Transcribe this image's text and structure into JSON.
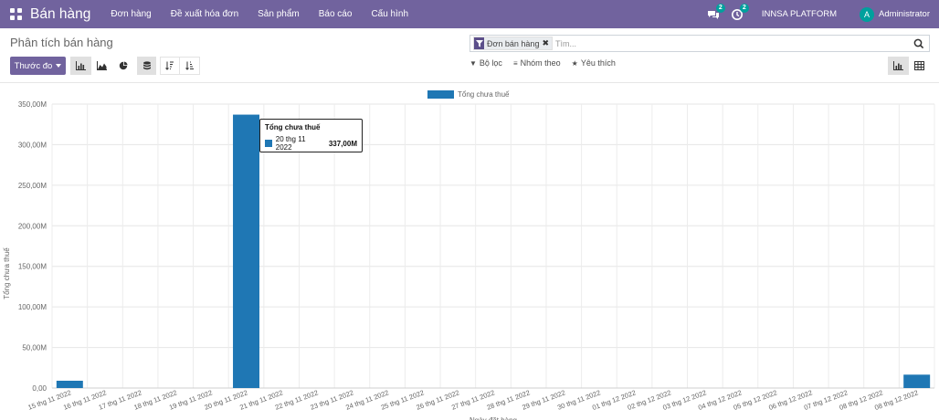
{
  "navbar": {
    "app_name": "Bán hàng",
    "menu": [
      "Đơn hàng",
      "Đề xuất hóa đơn",
      "Sản phẩm",
      "Báo cáo",
      "Cấu hình"
    ],
    "messages_count": "2",
    "activities_count": "2",
    "company": "INNSA PLATFORM",
    "user_initial": "A",
    "user_name": "Administrator"
  },
  "control_panel": {
    "breadcrumb": "Phân tích bán hàng",
    "measures_label": "Thước đo",
    "search": {
      "facet_label": "Đơn bán hàng",
      "placeholder": "Tìm..."
    },
    "filters_label": "Bộ lọc",
    "group_by_label": "Nhóm theo",
    "favorites_label": "Yêu thích"
  },
  "tooltip": {
    "title": "Tổng chưa thuế",
    "label": "20 thg 11 2022",
    "value": "337,00M"
  },
  "colors": {
    "navbar": "#71639e",
    "bar": "#1f77b4",
    "badge": "#00a09d"
  },
  "chart_data": {
    "type": "bar",
    "ylabel": "Tổng chưa thuế",
    "xlabel": "Ngày đặt hàng",
    "ylim": [
      0,
      350
    ],
    "yticks": [
      "0,00",
      "50,00M",
      "100,00M",
      "150,00M",
      "200,00M",
      "250,00M",
      "300,00M",
      "350,00M"
    ],
    "grid": true,
    "legend_position": "top",
    "series": [
      {
        "name": "Tổng chưa thuế",
        "values": [
          9,
          0,
          0,
          0,
          0,
          337,
          0,
          0,
          0,
          0,
          0,
          0,
          0,
          0,
          0,
          0,
          0,
          0,
          0,
          0,
          0,
          0,
          0,
          0,
          16.5
        ]
      }
    ],
    "categories": [
      "15 thg 11 2022",
      "16 thg 11 2022",
      "17 thg 11 2022",
      "18 thg 11 2022",
      "19 thg 11 2022",
      "20 thg 11 2022",
      "21 thg 11 2022",
      "22 thg 11 2022",
      "23 thg 11 2022",
      "24 thg 11 2022",
      "25 thg 11 2022",
      "26 thg 11 2022",
      "27 thg 11 2022",
      "28 thg 11 2022",
      "29 thg 11 2022",
      "30 thg 11 2022",
      "01 thg 12 2022",
      "02 thg 12 2022",
      "03 thg 12 2022",
      "04 thg 12 2022",
      "05 thg 12 2022",
      "06 thg 12 2022",
      "07 thg 12 2022",
      "08 thg 12 2022",
      "08 thg 12 2022"
    ]
  }
}
